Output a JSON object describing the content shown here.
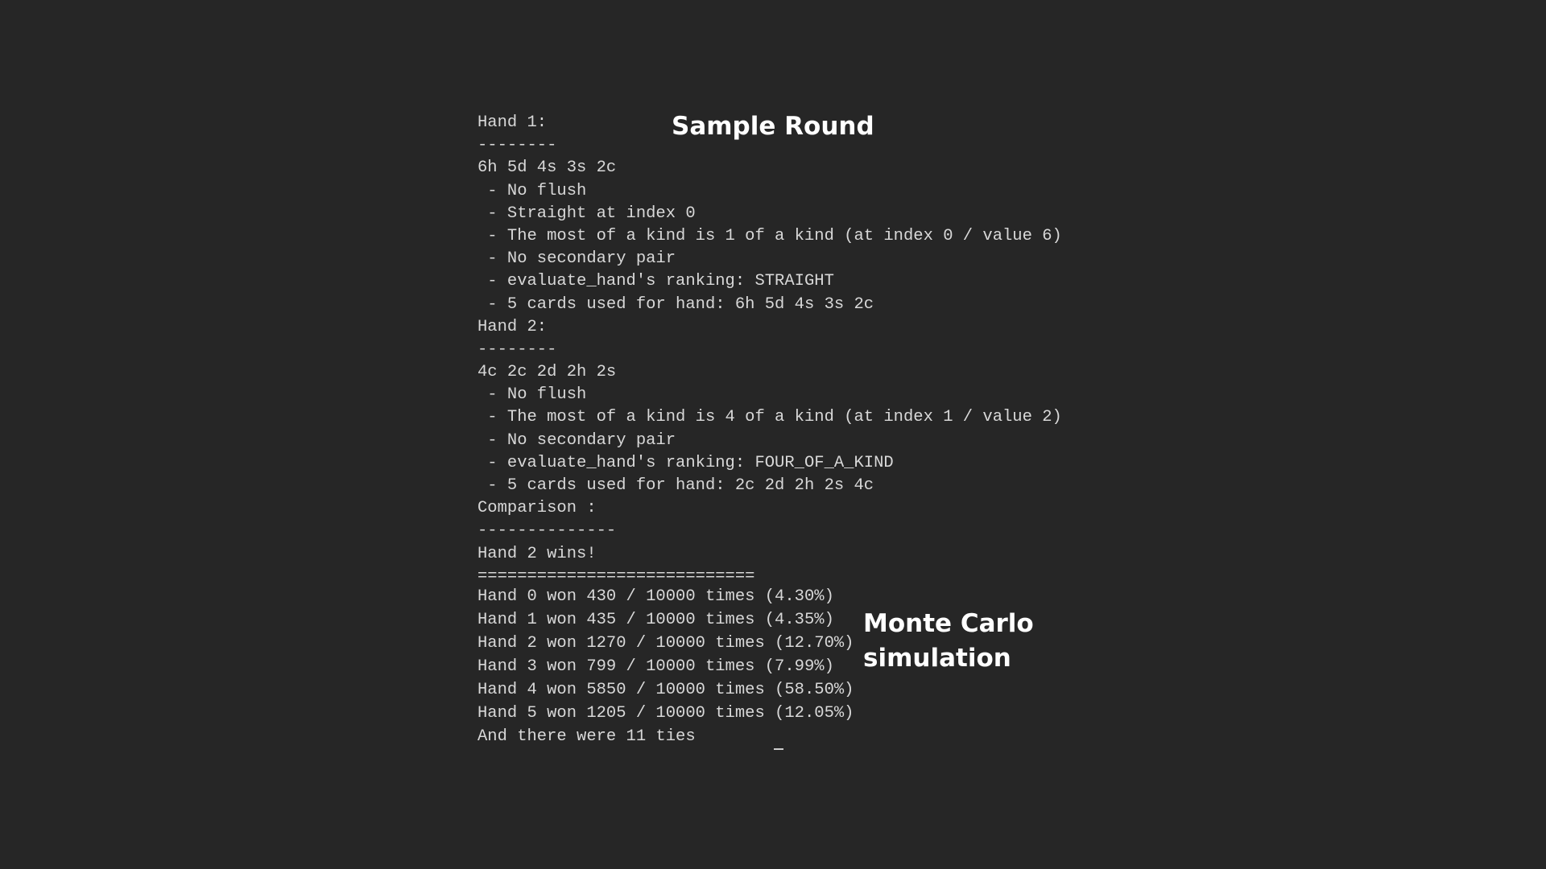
{
  "headings": {
    "sample_round": "Sample Round",
    "monte_carlo_line1": "Monte Carlo",
    "monte_carlo_line2": "simulation"
  },
  "terminal_lines": [
    "Hand 1:",
    "--------",
    "6h 5d 4s 3s 2c",
    " - No flush",
    " - Straight at index 0",
    " - The most of a kind is 1 of a kind (at index 0 / value 6)",
    " - No secondary pair",
    " - evaluate_hand's ranking: STRAIGHT",
    " - 5 cards used for hand: 6h 5d 4s 3s 2c",
    "Hand 2:",
    "--------",
    "4c 2c 2d 2h 2s",
    " - No flush",
    " - The most of a kind is 4 of a kind (at index 1 / value 2)",
    " - No secondary pair",
    " - evaluate_hand's ranking: FOUR_OF_A_KIND",
    " - 5 cards used for hand: 2c 2d 2h 2s 4c",
    "Comparison :",
    "--------------",
    "Hand 2 wins!",
    "============================"
  ],
  "simulation_lines": [
    "Hand 0 won 430 / 10000 times (4.30%)",
    "Hand 1 won 435 / 10000 times (4.35%)",
    "Hand 2 won 1270 / 10000 times (12.70%)",
    "Hand 3 won 799 / 10000 times (7.99%)",
    "Hand 4 won 5850 / 10000 times (58.50%)",
    "Hand 5 won 1205 / 10000 times (12.05%)",
    "And there were 11 ties"
  ]
}
